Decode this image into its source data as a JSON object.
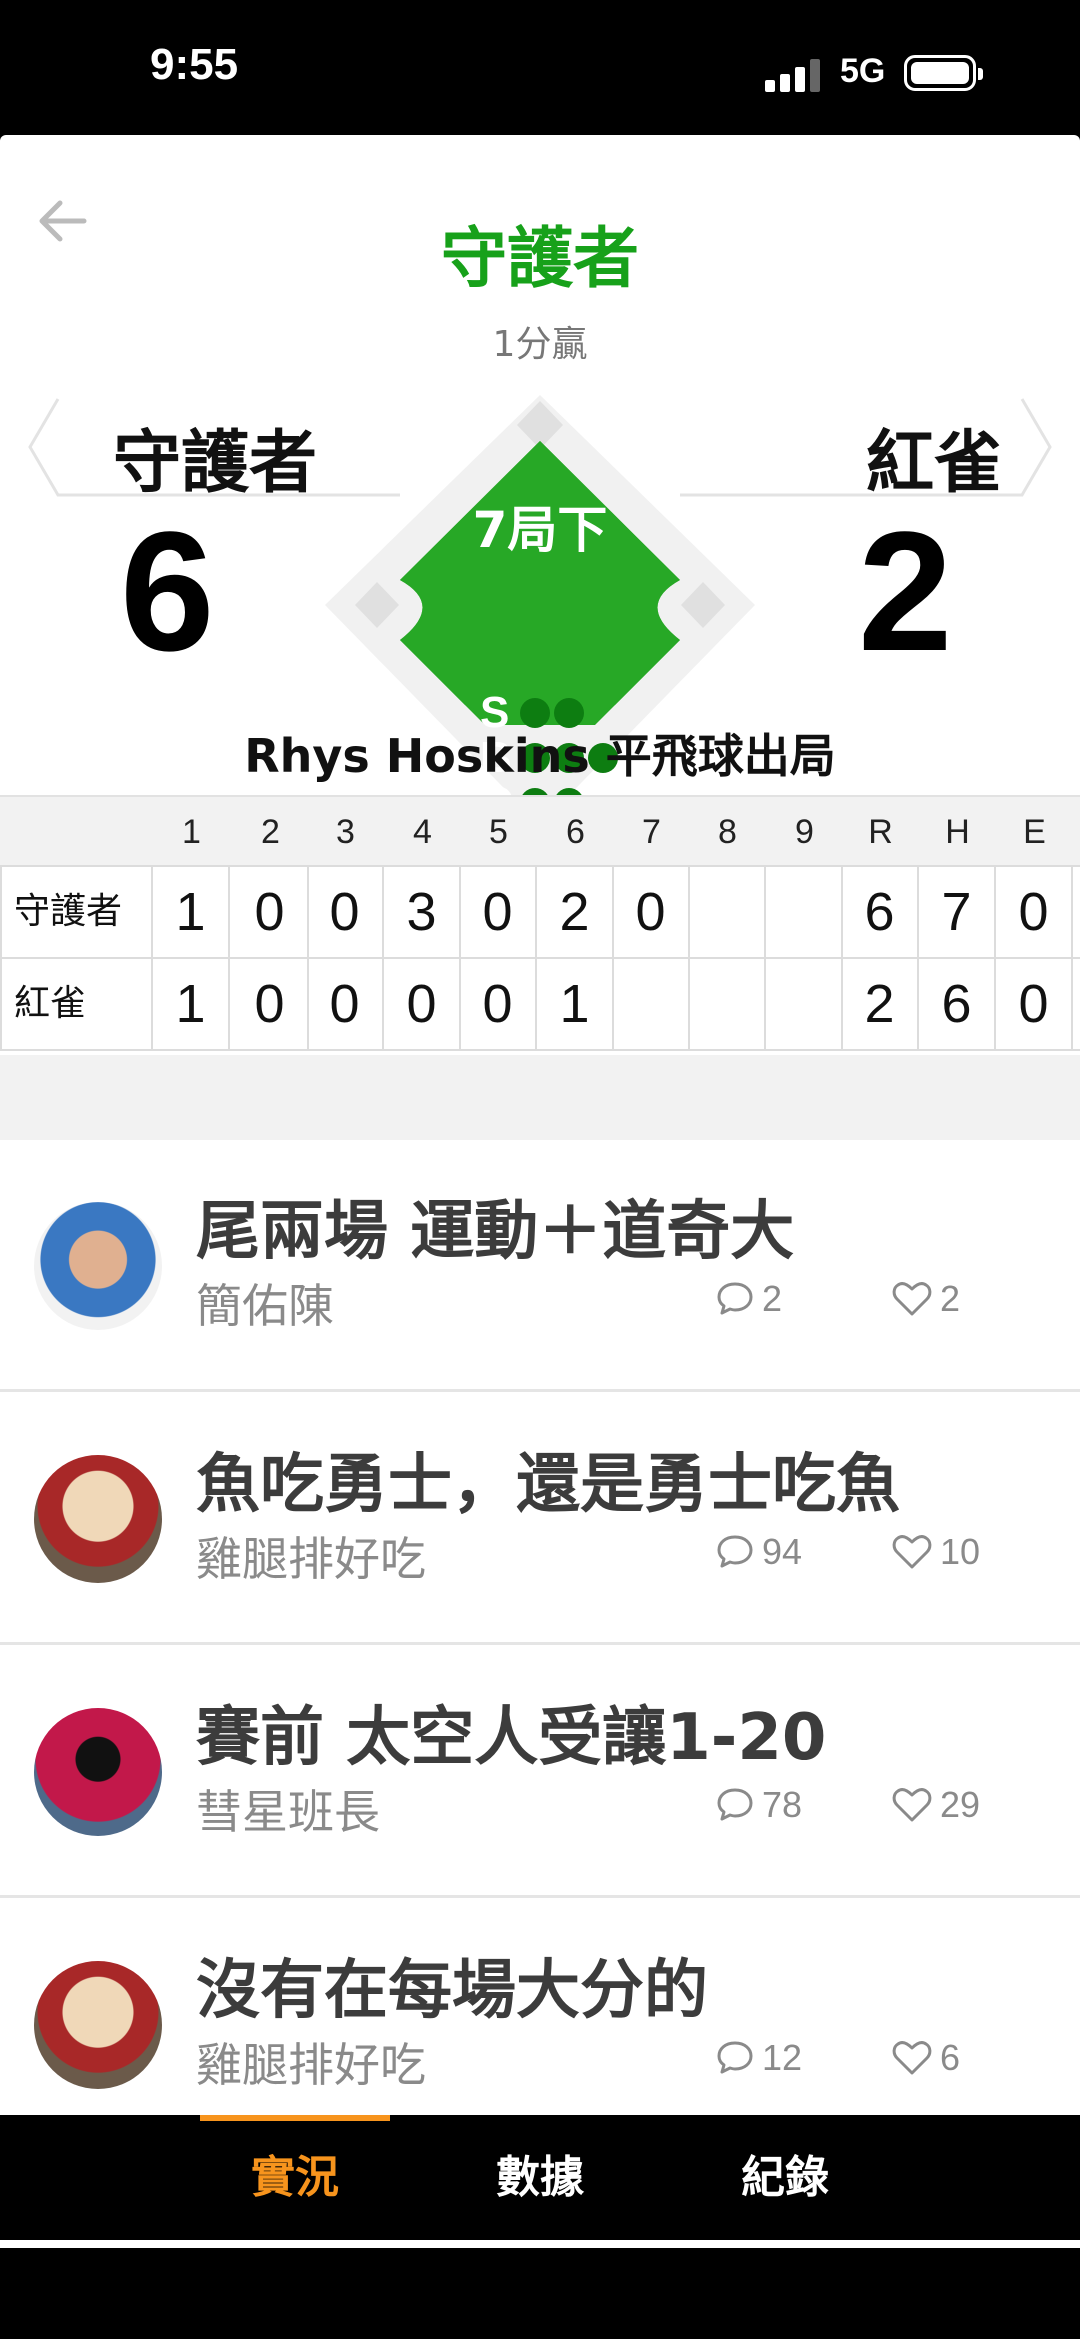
{
  "status_bar": {
    "time": "9:55",
    "network": "5G"
  },
  "header": {
    "title": "守護者",
    "subtitle": "1分贏"
  },
  "teams": {
    "away": {
      "name": "守護者",
      "score": "6"
    },
    "home": {
      "name": "紅雀",
      "score": "2"
    }
  },
  "game_state": {
    "inning": "7局下",
    "count": [
      {
        "letter": "S",
        "dots": 2,
        "filled": 0
      },
      {
        "letter": "B",
        "dots": 3,
        "filled": 0
      },
      {
        "letter": "O",
        "dots": 2,
        "filled": 0
      }
    ],
    "last_play": "Rhys Hoskins 平飛球出局"
  },
  "linescore": {
    "headers": [
      "1",
      "2",
      "3",
      "4",
      "5",
      "6",
      "7",
      "8",
      "9",
      "R",
      "H",
      "E"
    ],
    "rows": [
      {
        "team": "守護者",
        "cells": [
          "1",
          "0",
          "0",
          "3",
          "0",
          "2",
          "0",
          "",
          "",
          "6",
          "7",
          "0"
        ]
      },
      {
        "team": "紅雀",
        "cells": [
          "1",
          "0",
          "0",
          "0",
          "0",
          "1",
          "",
          "",
          "",
          "2",
          "6",
          "0"
        ]
      }
    ]
  },
  "posts": [
    {
      "title": "尾兩場 運動＋道奇大",
      "author": "簡佑陳",
      "comments": "2",
      "likes": "2"
    },
    {
      "title": "魚吃勇士，還是勇士吃魚",
      "author": "雞腿排好吃",
      "comments": "94",
      "likes": "10"
    },
    {
      "title": "賽前 太空人受讓1-20",
      "author": "彗星班長",
      "comments": "78",
      "likes": "29"
    },
    {
      "title": "沒有在每場大分的",
      "author": "雞腿排好吃",
      "comments": "12",
      "likes": "6"
    }
  ],
  "tabs": [
    {
      "label": "實況",
      "active": true
    },
    {
      "label": "數據",
      "active": false
    },
    {
      "label": "紀錄",
      "active": false
    }
  ],
  "colors": {
    "accent_green": "#17a11a",
    "diamond_green": "#27a826",
    "tab_active": "#f7941d"
  }
}
